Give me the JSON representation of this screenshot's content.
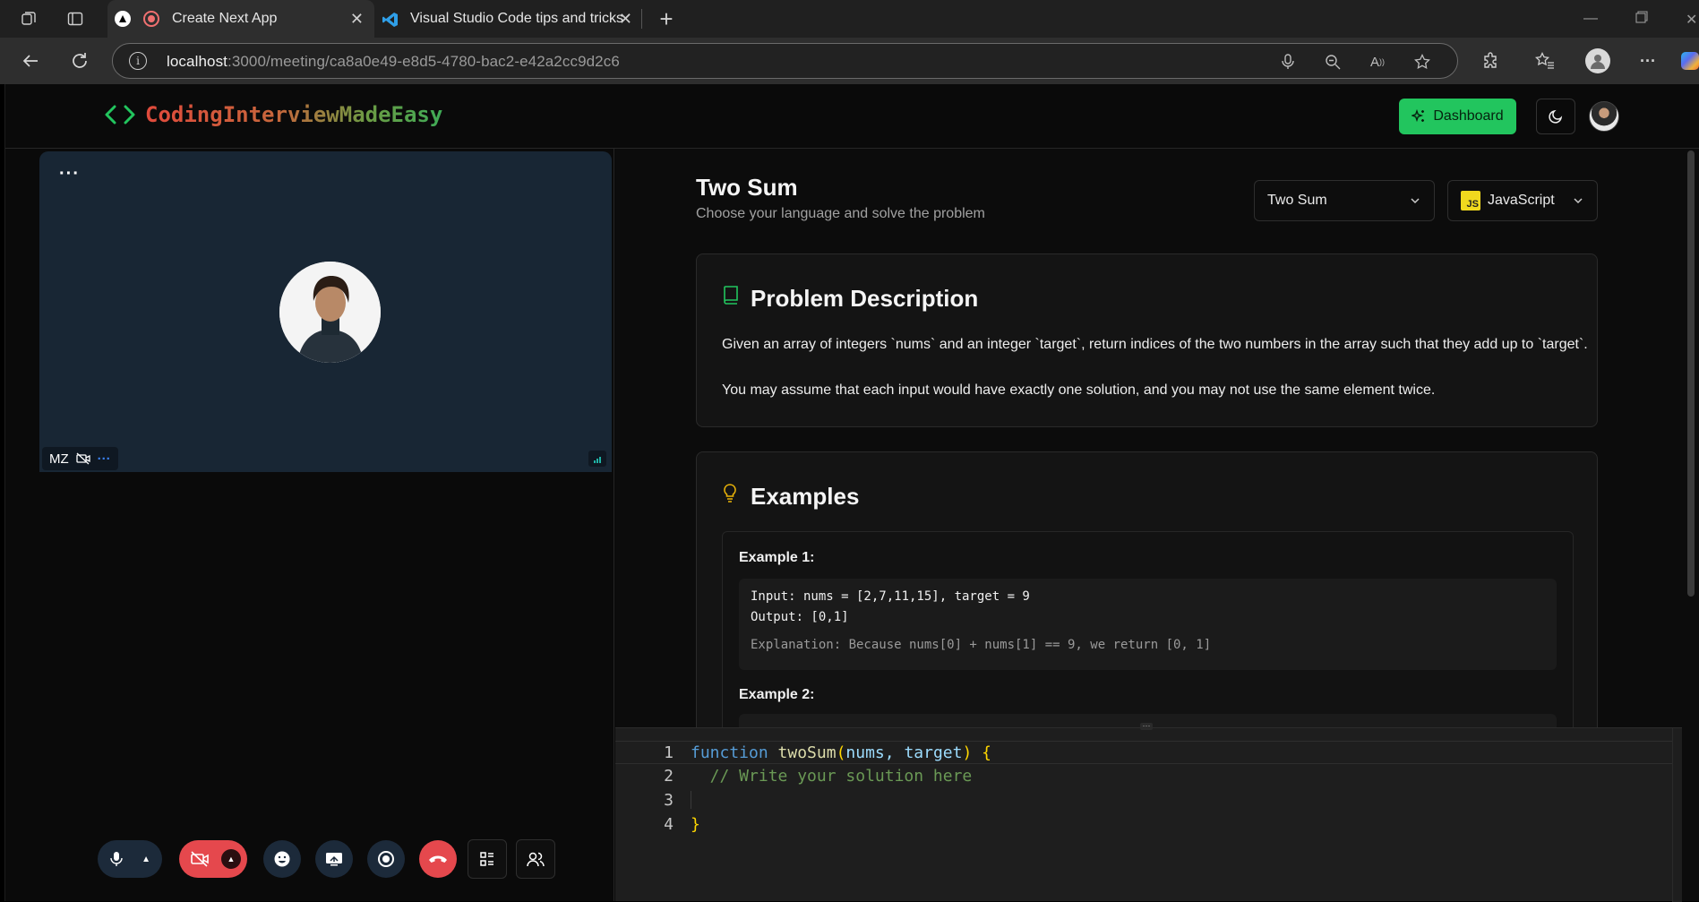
{
  "browser": {
    "tabs": [
      {
        "title": "Create Next App",
        "active": true
      },
      {
        "title": "Visual Studio Code tips and tricks",
        "active": false
      }
    ],
    "url_host": "localhost",
    "url_path": ":3000/meeting/ca8a0e49-e8d5-4780-bac2-e42a2cc9d2c6"
  },
  "header": {
    "brand": "CodingInterviewMadeEasy",
    "dashboard_label": "Dashboard"
  },
  "video": {
    "participant_initials": "MZ"
  },
  "problem": {
    "title": "Two Sum",
    "subtitle": "Choose your language and solve the problem",
    "question_select": "Two Sum",
    "language_select": "JavaScript",
    "js_badge": "JS",
    "description_heading": "Problem Description",
    "description": [
      "Given an array of integers `nums` and an integer `target`, return indices of the two numbers in the array such that they add up to `target`.",
      "You may assume that each input would have exactly one solution, and you may not use the same element twice."
    ],
    "examples_heading": "Examples",
    "examples": [
      {
        "label": "Example 1:",
        "input": "Input: nums = [2,7,11,15], target = 9",
        "output": "Output: [0,1]",
        "explanation": "Explanation: Because nums[0] + nums[1] == 9, we return [0, 1]"
      },
      {
        "label": "Example 2:"
      }
    ]
  },
  "editor": {
    "line_numbers": [
      "1",
      "2",
      "3",
      "4"
    ],
    "line1": {
      "kw": "function",
      "fn": "twoSum",
      "open": "(",
      "params": "nums, target",
      "close": ")",
      "brace": "{"
    },
    "line2": "  // Write your solution here",
    "line4": "}"
  },
  "colors": {
    "accent": "#22c55e",
    "video_bg": "#182634",
    "end_call": "#e5484d"
  }
}
